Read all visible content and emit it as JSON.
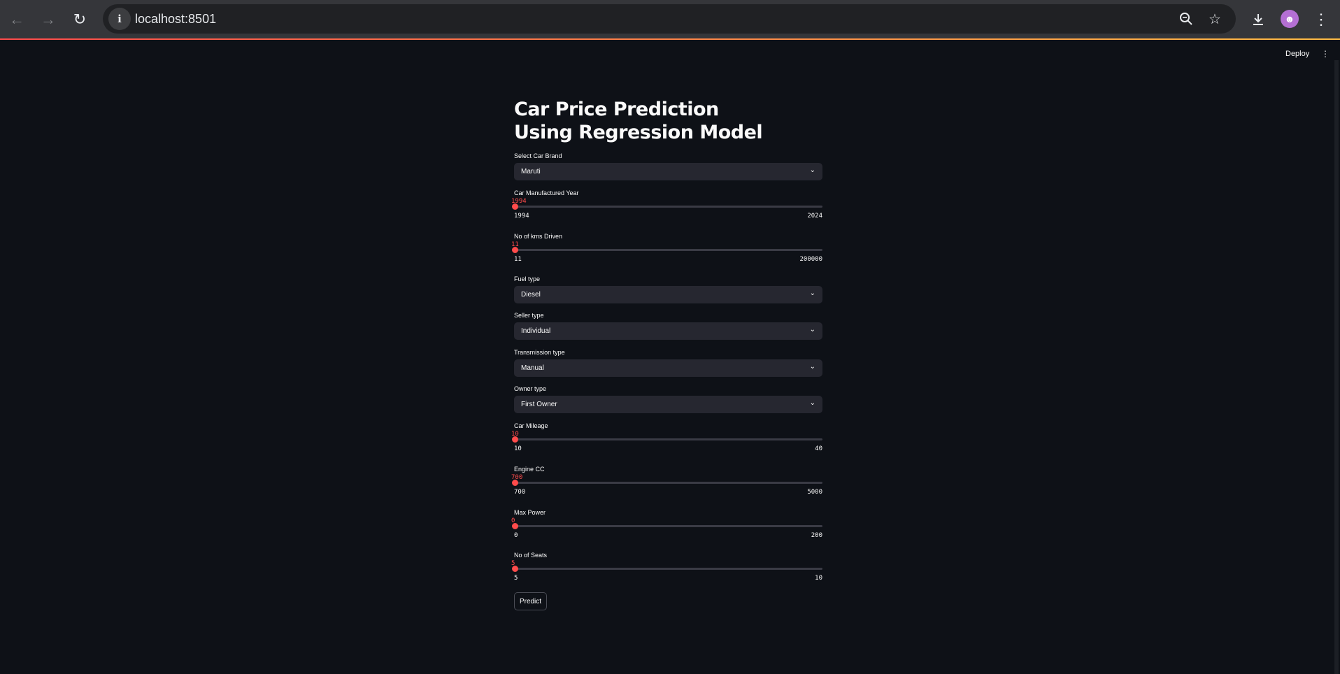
{
  "browser": {
    "url": "localhost:8501",
    "icons": {
      "back": "arrow-left-icon",
      "forward": "arrow-right-icon",
      "reload": "reload-icon",
      "info": "info-icon",
      "zoom": "zoom-out-icon",
      "bookmark": "star-icon",
      "download": "download-icon",
      "menu": "kebab-menu-icon"
    }
  },
  "header": {
    "deploy_label": "Deploy"
  },
  "app": {
    "title": "Car Price Prediction Using Regression Model",
    "accent_color": "#ff4b4b",
    "brand": {
      "label": "Select Car Brand",
      "value": "Maruti"
    },
    "year": {
      "label": "Car Manufactured Year",
      "value": "1994",
      "min": "1994",
      "max": "2024"
    },
    "kms": {
      "label": "No of kms Driven",
      "value": "11",
      "min": "11",
      "max": "200000"
    },
    "fuel": {
      "label": "Fuel type",
      "value": "Diesel"
    },
    "seller": {
      "label": "Seller type",
      "value": "Individual"
    },
    "transmission": {
      "label": "Transmission type",
      "value": "Manual"
    },
    "owner": {
      "label": "Owner type",
      "value": "First Owner"
    },
    "mileage": {
      "label": "Car Mileage",
      "value": "10",
      "min": "10",
      "max": "40"
    },
    "engine": {
      "label": "Engine CC",
      "value": "700",
      "min": "700",
      "max": "5000"
    },
    "power": {
      "label": "Max Power",
      "value": "0",
      "min": "0",
      "max": "200"
    },
    "seats": {
      "label": "No of Seats",
      "value": "5",
      "min": "5",
      "max": "10"
    },
    "predict_label": "Predict"
  }
}
